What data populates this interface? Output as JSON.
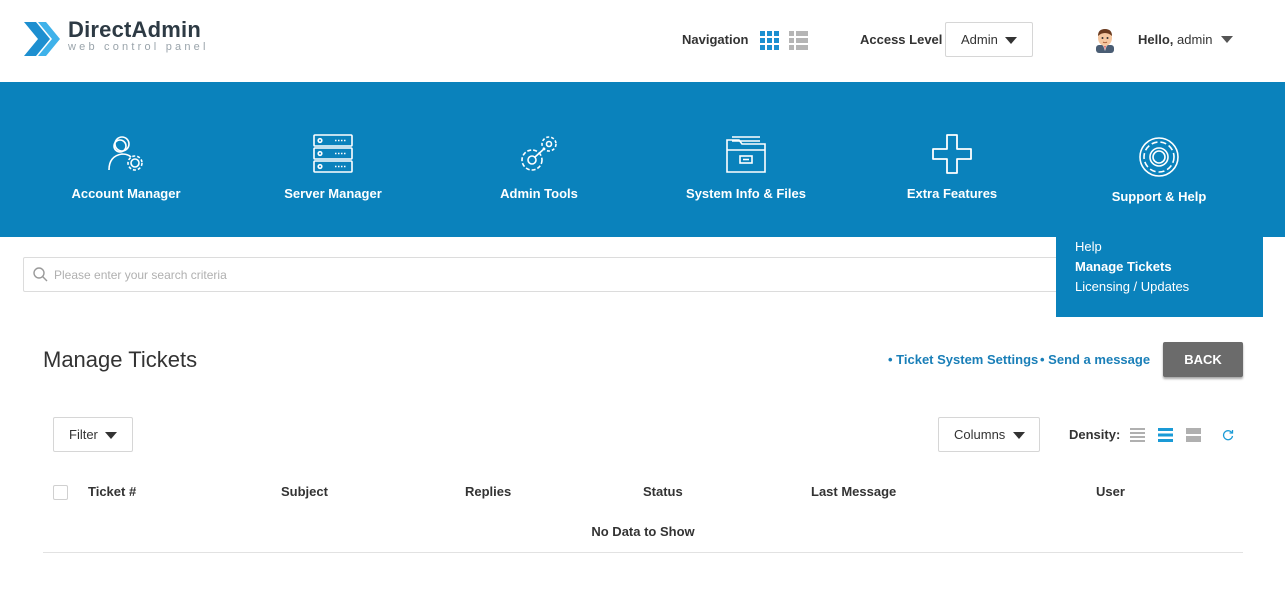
{
  "header": {
    "logo_title": "DirectAdmin",
    "logo_subtitle": "web control panel",
    "navigation_label": "Navigation",
    "access_level_label": "Access Level",
    "access_level_value": "Admin",
    "greeting": "Hello,",
    "username": "admin"
  },
  "colors": {
    "brand_blue": "#0a82bc",
    "link_blue": "#1a7fb8",
    "back_button": "#6b6b6b",
    "density_active": "#1a9ad6"
  },
  "main_menu": [
    {
      "label": "Account Manager",
      "icon": "account-gear-icon"
    },
    {
      "label": "Server Manager",
      "icon": "server-rack-icon"
    },
    {
      "label": "Admin Tools",
      "icon": "admin-tools-gears-icon"
    },
    {
      "label": "System Info & Files",
      "icon": "folder-files-icon"
    },
    {
      "label": "Extra Features",
      "icon": "plus-icon"
    },
    {
      "label": "Support & Help",
      "icon": "lifebuoy-icon"
    }
  ],
  "support_dropdown": {
    "items": [
      {
        "label": "Help",
        "active": false
      },
      {
        "label": "Manage Tickets",
        "active": true
      },
      {
        "label": "Licensing / Updates",
        "active": false
      }
    ]
  },
  "search": {
    "placeholder": "Please enter your search criteria"
  },
  "page": {
    "title": "Manage Tickets",
    "link_settings": "• Ticket System Settings",
    "link_send": "• Send a message",
    "back_label": "BACK"
  },
  "toolbar": {
    "filter_label": "Filter",
    "columns_label": "Columns",
    "density_label": "Density:"
  },
  "table": {
    "columns": [
      "Ticket #",
      "Subject",
      "Replies",
      "Status",
      "Last Message",
      "User"
    ],
    "empty_text": "No Data to Show"
  }
}
